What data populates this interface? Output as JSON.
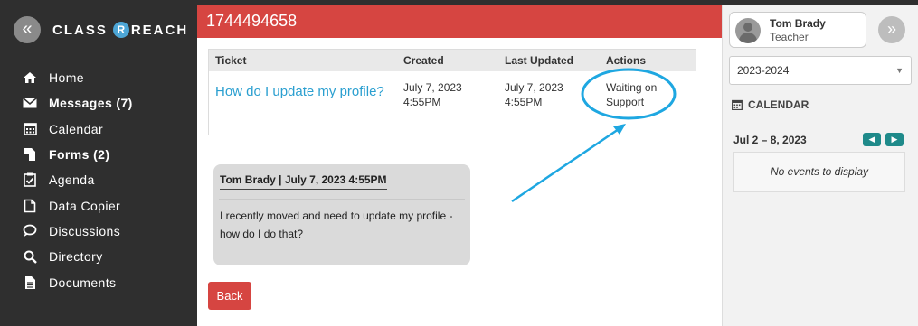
{
  "sidebar": {
    "logo_text_a": "CLASS",
    "logo_text_b": "REACH",
    "collapse_icon": "«",
    "items": [
      {
        "label": "Home",
        "icon": "home-icon"
      },
      {
        "label": "Messages (7)",
        "icon": "envelope-icon"
      },
      {
        "label": "Calendar",
        "icon": "calendar-icon"
      },
      {
        "label": "Forms (2)",
        "icon": "forms-icon"
      },
      {
        "label": "Agenda",
        "icon": "checklist-icon"
      },
      {
        "label": "Data Copier",
        "icon": "copy-icon"
      },
      {
        "label": "Discussions",
        "icon": "chat-bubble-icon"
      },
      {
        "label": "Directory",
        "icon": "search-icon"
      },
      {
        "label": "Documents",
        "icon": "document-icon"
      }
    ]
  },
  "header": {
    "title": "1744494658",
    "color": "#d64541"
  },
  "ticket_table": {
    "columns": [
      "Ticket",
      "Created",
      "Last Updated",
      "Actions"
    ],
    "row": {
      "ticket": "How do I update my profile?",
      "created_date": "July 7, 2023",
      "created_time": "4:55PM",
      "updated_date": "July 7, 2023",
      "updated_time": "4:55PM",
      "action_line1": "Waiting on",
      "action_line2": "Support"
    }
  },
  "message": {
    "header": "Tom Brady | July 7, 2023 4:55PM",
    "body_line1": "I recently moved and need to update my profile -",
    "body_line2": "how do I do that?"
  },
  "back_button": {
    "label": "Back"
  },
  "user": {
    "name": "Tom Brady",
    "role": "Teacher"
  },
  "expand_icon": "»",
  "year_select": {
    "value": "2023-2024"
  },
  "calendar": {
    "heading": "CALENDAR",
    "week": "Jul 2 – 8, 2023",
    "empty_text": "No events to display"
  },
  "colors": {
    "accent_red": "#d64541",
    "link_blue": "#2a9fd0",
    "annotation_blue": "#1ea7e1",
    "sidebar_bg": "#2f2f2f",
    "calendar_nav": "#1f8a8a"
  }
}
